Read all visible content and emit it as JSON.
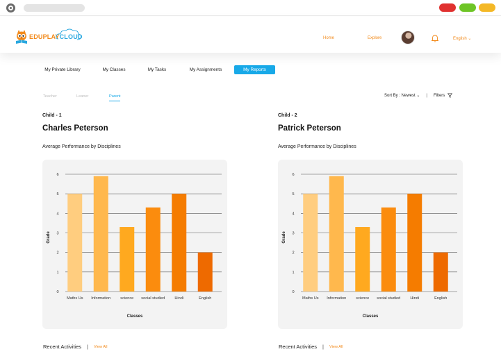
{
  "app": {
    "logo_part1": "EDU",
    "logo_part2": "PLAY",
    "logo_part3": "CLOUD"
  },
  "browser": {
    "buttons": [
      "#e0312f",
      "#6ec526",
      "#f4b826"
    ]
  },
  "header": {
    "nav": [
      {
        "label": "Home"
      },
      {
        "label": "Explore"
      }
    ],
    "language": "English",
    "accent": "#f28a1b"
  },
  "tabs": [
    {
      "label": "My Private Library",
      "active": false
    },
    {
      "label": "My Classes",
      "active": false
    },
    {
      "label": "My Tasks",
      "active": false
    },
    {
      "label": "My Assignments",
      "active": false
    },
    {
      "label": "My Reports",
      "active": true
    }
  ],
  "subtabs": [
    {
      "label": "Teacher",
      "active": false
    },
    {
      "label": "Leaner",
      "active": false
    },
    {
      "label": "Parent",
      "active": true
    }
  ],
  "sort": {
    "label": "Sort By : Newest",
    "filters": "Filters"
  },
  "children": [
    {
      "label": "Child - 1",
      "name": "Charles Peterson",
      "perf_title": "Average Performance  by Disciplines",
      "recent_title": "Recent Activities",
      "view_all": "View All"
    },
    {
      "label": "Child - 2",
      "name": "Patrick Peterson",
      "perf_title": "Average Performance  by Disciplines",
      "recent_title": "Recent Activities",
      "view_all": "View All"
    }
  ],
  "chart_data": [
    {
      "type": "bar",
      "categories": [
        "Maths Us",
        "Information",
        "science",
        "social studied",
        "Hindi",
        "English"
      ],
      "values": [
        5,
        5.9,
        3.3,
        4.3,
        5,
        2
      ],
      "colors": [
        "#ffcd7f",
        "#ffb84d",
        "#ffa91f",
        "#fb8c0e",
        "#f57c00",
        "#ee6a00"
      ],
      "xlabel": "Classes",
      "ylabel": "Grade",
      "ylim": [
        0,
        6
      ],
      "yticks": [
        "0",
        "1",
        "2",
        "3",
        "4",
        "5",
        "6"
      ],
      "grid": true
    },
    {
      "type": "bar",
      "categories": [
        "Maths Us",
        "Information",
        "science",
        "social studied",
        "Hindi",
        "English"
      ],
      "values": [
        5,
        5.9,
        3.3,
        4.3,
        5,
        2
      ],
      "colors": [
        "#ffcd7f",
        "#ffb84d",
        "#ffa91f",
        "#fb8c0e",
        "#f57c00",
        "#ee6a00"
      ],
      "xlabel": "Classes",
      "ylabel": "Grade",
      "ylim": [
        0,
        6
      ],
      "yticks": [
        "0",
        "1",
        "2",
        "3",
        "4",
        "5",
        "6"
      ],
      "grid": true
    }
  ]
}
